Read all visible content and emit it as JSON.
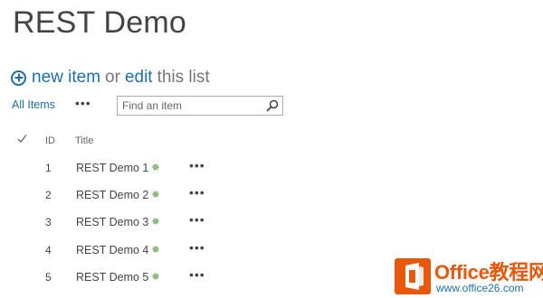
{
  "page": {
    "title": "REST Demo"
  },
  "command_bar": {
    "new_item": "new item",
    "or": "or",
    "edit": "edit",
    "this_list": "this list"
  },
  "view": {
    "current": "All Items",
    "more_label": "•••"
  },
  "search": {
    "placeholder": "Find an item"
  },
  "list": {
    "columns": {
      "id": "ID",
      "title": "Title"
    },
    "rows": [
      {
        "id": "1",
        "title": "REST Demo 1"
      },
      {
        "id": "2",
        "title": "REST Demo 2"
      },
      {
        "id": "3",
        "title": "REST Demo 3"
      },
      {
        "id": "4",
        "title": "REST Demo 4"
      },
      {
        "id": "5",
        "title": "REST Demo 5"
      }
    ],
    "new_marker": "✵",
    "row_menu": "•••"
  },
  "watermark": {
    "brand": "Office教程网",
    "url": "www.office26.com"
  },
  "colors": {
    "accent": "#1e6fa5",
    "new_marker": "#3a8a21",
    "brand_orange": "#e8580c"
  },
  "icons": {
    "add": "circle-plus-icon",
    "search": "magnifier-icon",
    "select_all": "check-icon",
    "new_item": "new-star-icon",
    "logo": "office-logo-icon"
  }
}
